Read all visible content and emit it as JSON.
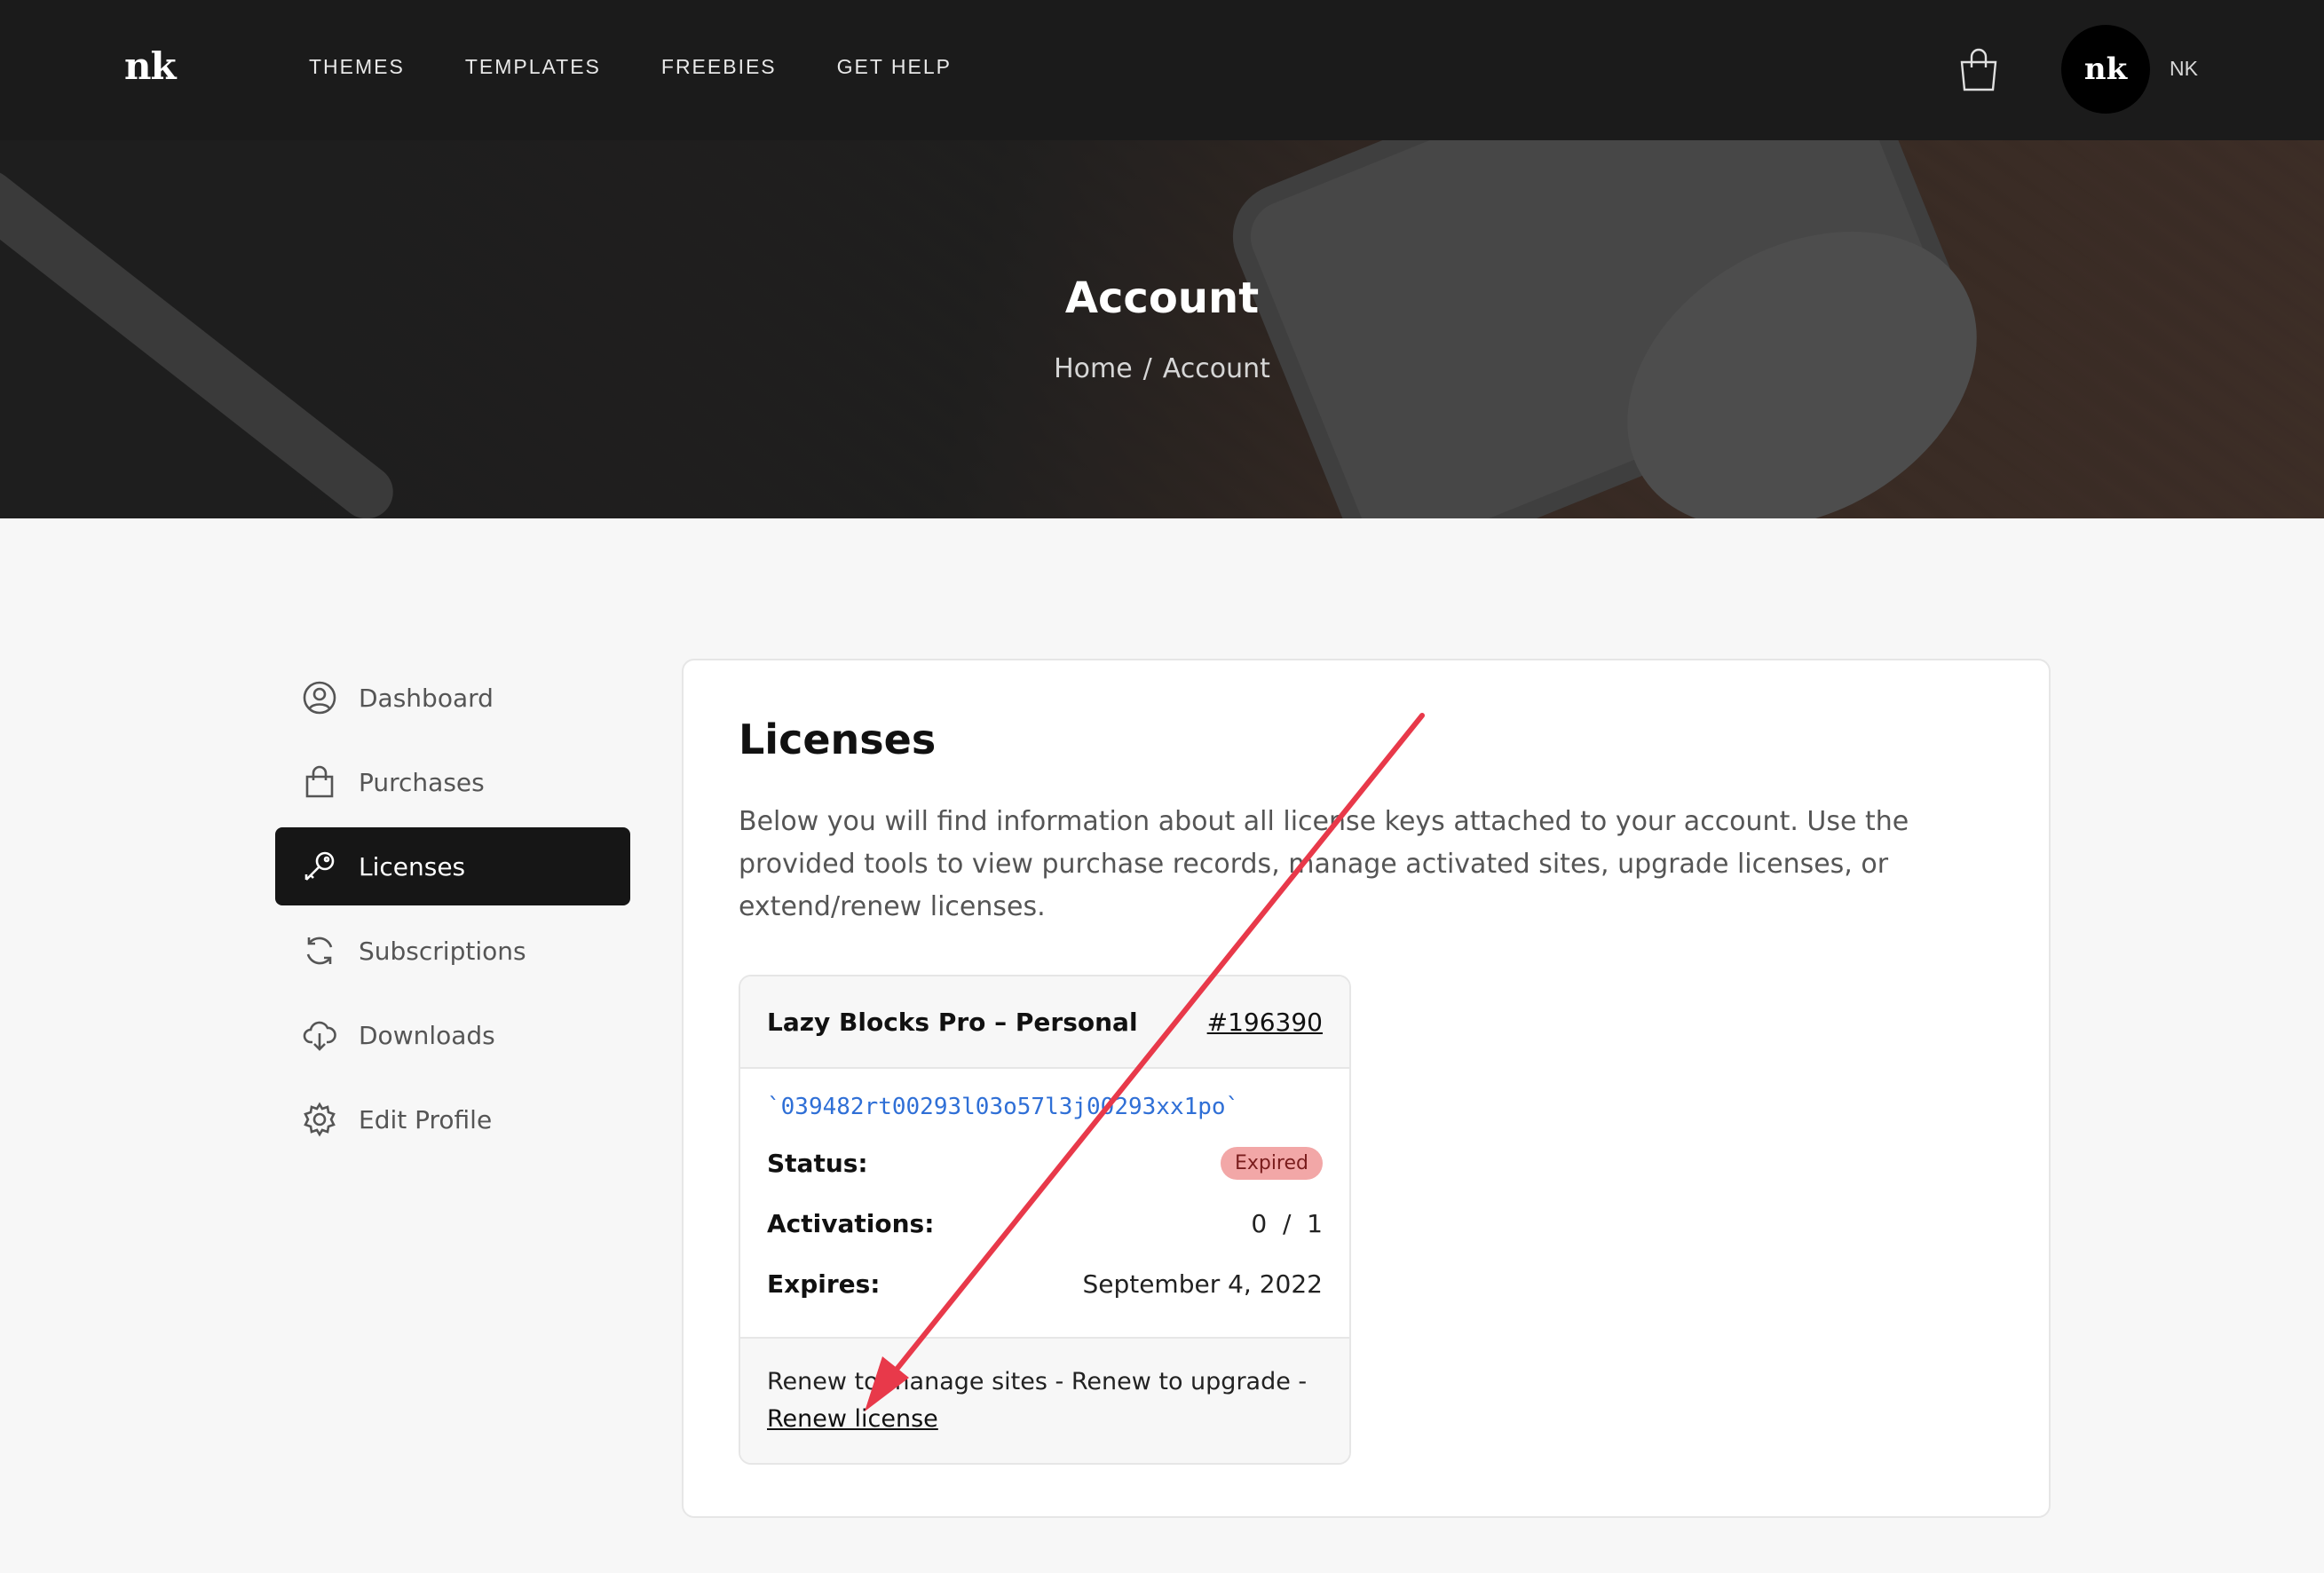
{
  "brand": {
    "logo": "nk"
  },
  "nav": [
    "THEMES",
    "TEMPLATES",
    "FREEBIES",
    "GET HELP"
  ],
  "user": {
    "avatar": "nk",
    "name": "NK"
  },
  "hero": {
    "title": "Account",
    "breadcrumb": {
      "home": "Home",
      "sep": "/",
      "current": "Account"
    }
  },
  "sidebar": {
    "items": [
      {
        "label": "Dashboard",
        "icon": "user-circle-icon"
      },
      {
        "label": "Purchases",
        "icon": "bag-icon"
      },
      {
        "label": "Licenses",
        "icon": "key-icon",
        "active": true
      },
      {
        "label": "Subscriptions",
        "icon": "refresh-icon"
      },
      {
        "label": "Downloads",
        "icon": "cloud-download-icon"
      },
      {
        "label": "Edit Profile",
        "icon": "gear-icon"
      }
    ]
  },
  "main": {
    "title": "Licenses",
    "intro": "Below you will find information about all license keys attached to your account. Use the provided tools to view purchase records, manage activated sites, upgrade licenses, or extend/renew licenses.",
    "license": {
      "name": "Lazy Blocks Pro – Personal",
      "number": "#196390",
      "key": "`039482rt00293l03o57l3j00293xx1po`",
      "status_label": "Status:",
      "status_value": "Expired",
      "activations_label": "Activations:",
      "activations_value": "0  /  1",
      "expires_label": "Expires:",
      "expires_value": "September 4, 2022",
      "footer_text": "Renew to manage sites - Renew to upgrade -",
      "renew_link": "Renew license"
    }
  },
  "colors": {
    "topbar": "#1b1b1b",
    "active_item": "#161616",
    "key_link": "#2f6fd6",
    "badge_bg": "#f2a7a7",
    "arrow": "#e8394a"
  }
}
